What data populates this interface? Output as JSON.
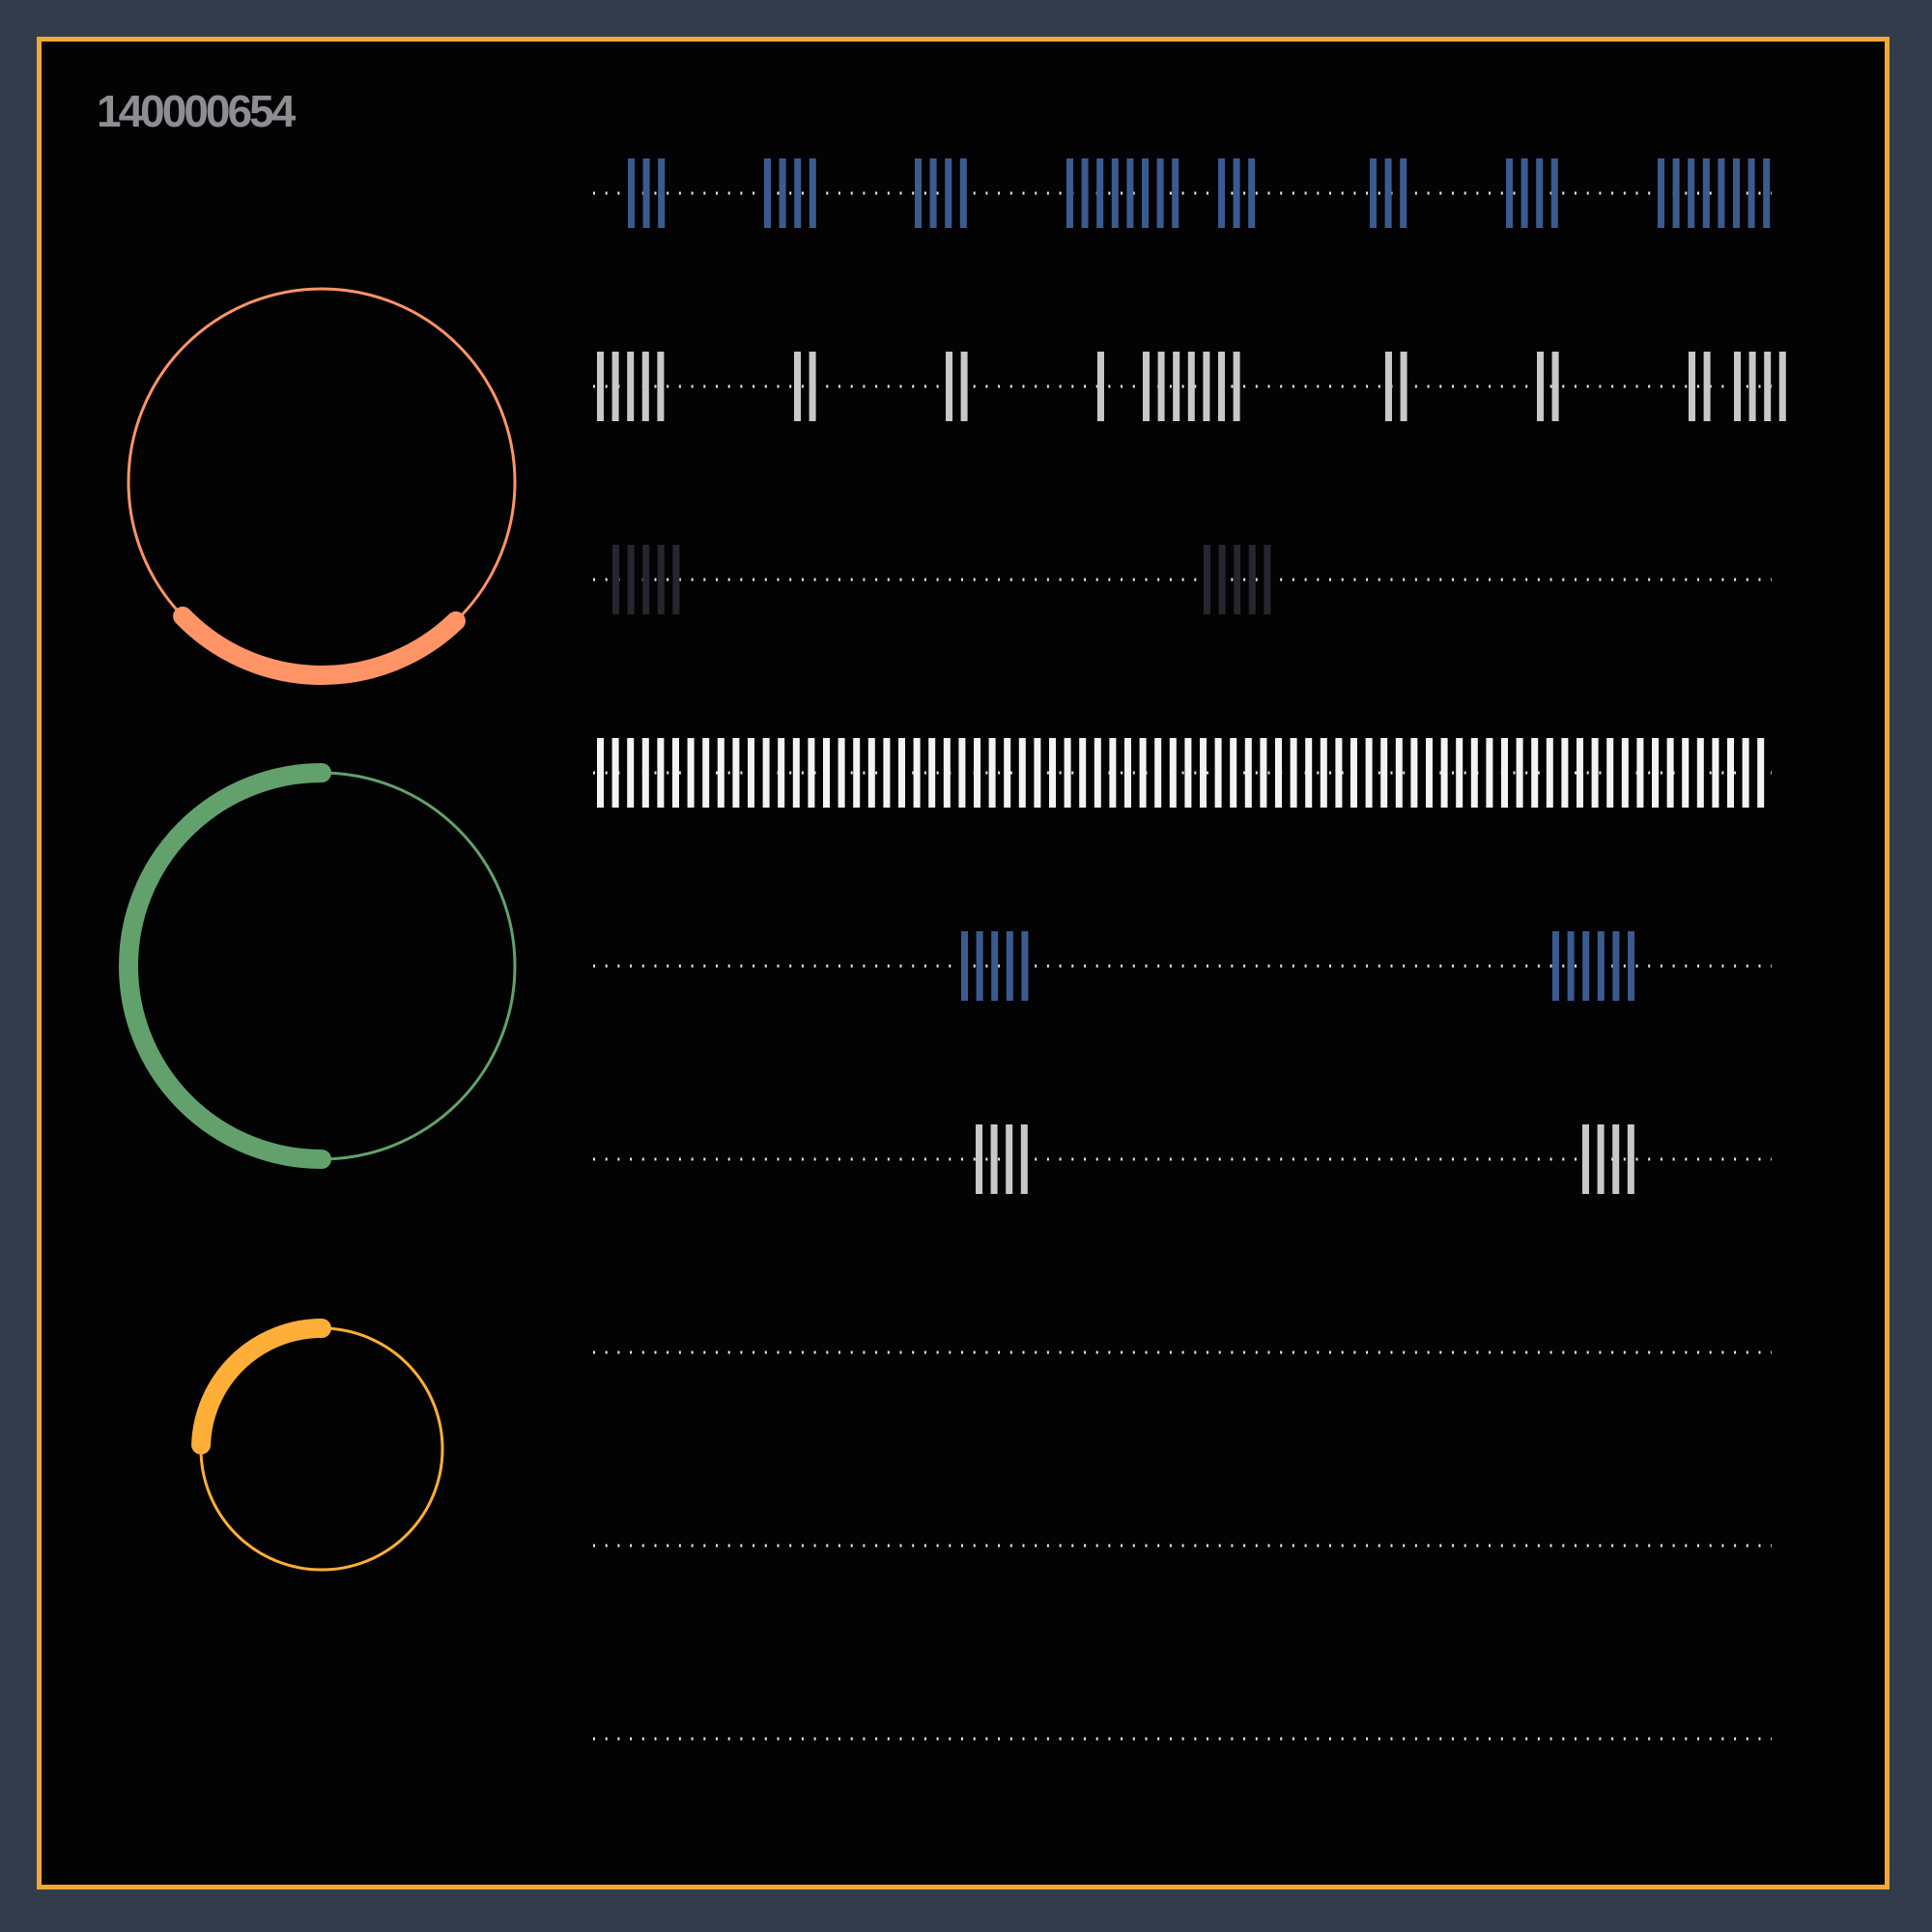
{
  "display": {
    "id_code": "140000654"
  },
  "colors": {
    "background": "#333c4a",
    "panel": "#030304",
    "frame_border": "#f5a83a",
    "id_text": "#8d8d92",
    "dots": "#e8e8e8"
  },
  "rings": [
    {
      "name": "ring-salmon",
      "color": "#ff9466",
      "arc_start_deg": 136,
      "arc_end_deg": 226
    },
    {
      "name": "ring-green",
      "color": "#62a16c",
      "arc_start_deg": 180,
      "arc_end_deg": 360
    },
    {
      "name": "ring-orange",
      "color": "#ffae38",
      "arc_start_deg": 272,
      "arc_end_deg": 360
    }
  ],
  "tracks": [
    {
      "color": "#3b5b90",
      "dotted": true,
      "groups": [
        {
          "start": 650,
          "count": 3
        },
        {
          "start": 791,
          "count": 4
        },
        {
          "start": 947,
          "count": 4
        },
        {
          "start": 1104,
          "count": 8
        },
        {
          "start": 1261,
          "count": 3
        },
        {
          "start": 1418,
          "count": 3
        },
        {
          "start": 1559,
          "count": 4
        },
        {
          "start": 1716,
          "count": 8
        }
      ]
    },
    {
      "color": "#c8c8c8",
      "dotted": true,
      "groups": [
        {
          "start": 618,
          "count": 5
        },
        {
          "start": 822,
          "count": 2
        },
        {
          "start": 979,
          "count": 2
        },
        {
          "start": 1136,
          "count": 1
        },
        {
          "start": 1183,
          "count": 7
        },
        {
          "start": 1434,
          "count": 2
        },
        {
          "start": 1591,
          "count": 2
        },
        {
          "start": 1748,
          "count": 2
        },
        {
          "start": 1795,
          "count": 4
        }
      ]
    },
    {
      "color": "#26262e",
      "dotted": true,
      "groups": [
        {
          "start": 634,
          "count": 5
        },
        {
          "start": 1246,
          "count": 5
        }
      ]
    },
    {
      "color": "#f3f3f3",
      "dotted": true,
      "groups": [
        {
          "start": 618,
          "count": 78
        }
      ]
    },
    {
      "color": "#3b5b90",
      "dotted": true,
      "groups": [
        {
          "start": 995,
          "count": 5
        },
        {
          "start": 1607,
          "count": 6
        }
      ]
    },
    {
      "color": "#c8c8c8",
      "dotted": true,
      "groups": [
        {
          "start": 1010,
          "count": 4
        },
        {
          "start": 1638,
          "count": 4
        }
      ]
    },
    {
      "color": "#c8c8c8",
      "dotted": true,
      "groups": []
    },
    {
      "color": "#c8c8c8",
      "dotted": true,
      "groups": []
    },
    {
      "color": "#c8c8c8",
      "dotted": true,
      "groups": []
    }
  ]
}
